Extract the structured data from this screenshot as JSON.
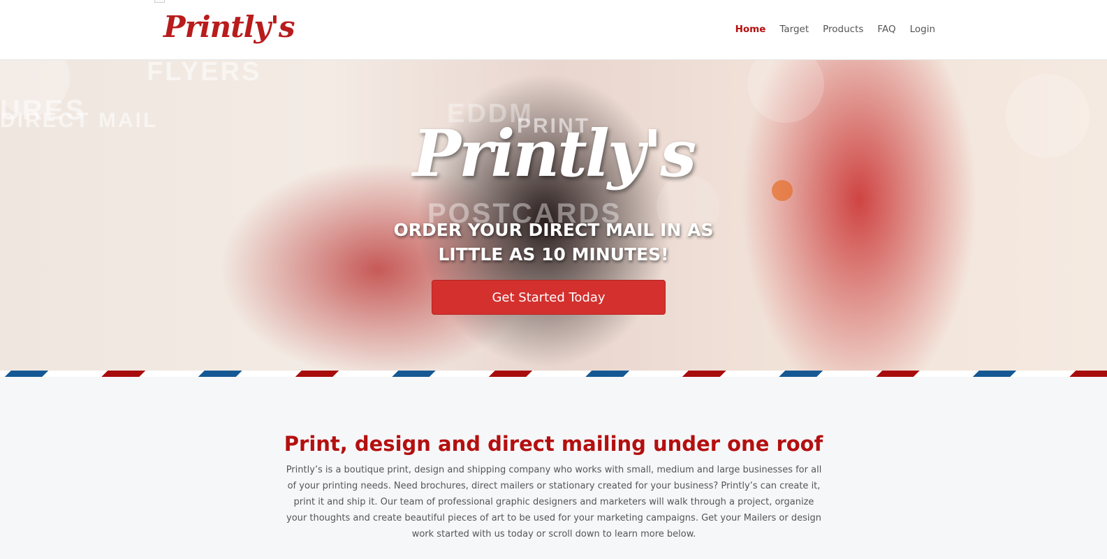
{
  "header": {
    "logo_text": "Printly's",
    "nav": [
      {
        "label": "Home",
        "active": true
      },
      {
        "label": "Target",
        "active": false
      },
      {
        "label": "Products",
        "active": false
      },
      {
        "label": "FAQ",
        "active": false
      },
      {
        "label": "Login",
        "active": false
      }
    ]
  },
  "hero": {
    "background_words": [
      "FLYERS",
      "URES",
      "DIRECT MAIL",
      "EDDM",
      "PRINT",
      "POSTCARDS"
    ],
    "logo_text": "Printly's",
    "headline_line1": "ORDER YOUR DIRECT MAIL IN AS",
    "headline_line2": "LITTLE AS 10 MINUTES!",
    "cta_label": "Get Started Today"
  },
  "about": {
    "title": "Print, design and direct mailing under one roof",
    "body": "Printly’s is a boutique print, design and shipping company who works with small, medium and large businesses for all of your printing needs. Need brochures, direct mailers or stationary created for your business? Printly’s can create it, print it and ship it. Our team of professional graphic designers and marketers will walk through a project, organize your thoughts and create beautiful pieces of art to be used for your marketing campaigns. Get your Mailers or design work started with us today or scroll down to learn more below."
  },
  "colors": {
    "brand_red": "#b40f0f",
    "cta_red": "#d3302e",
    "stripe_blue": "#155894"
  }
}
